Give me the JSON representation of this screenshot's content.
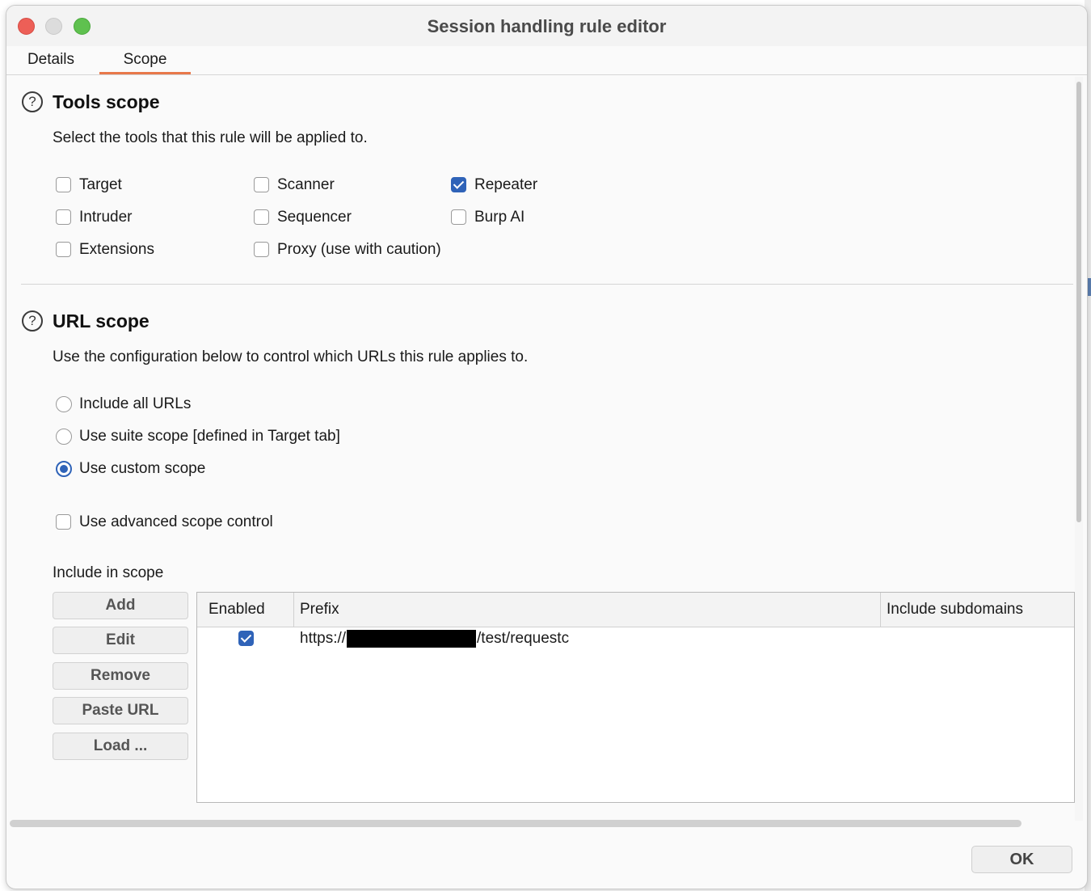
{
  "window": {
    "title": "Session handling rule editor"
  },
  "tabs": [
    {
      "label": "Details",
      "active": false
    },
    {
      "label": "Scope",
      "active": true
    }
  ],
  "tools_scope": {
    "title": "Tools scope",
    "description": "Select the tools that this rule will be applied to.",
    "tools": [
      {
        "label": "Target",
        "checked": false
      },
      {
        "label": "Scanner",
        "checked": false
      },
      {
        "label": "Repeater",
        "checked": true
      },
      {
        "label": "Intruder",
        "checked": false
      },
      {
        "label": "Sequencer",
        "checked": false
      },
      {
        "label": "Burp AI",
        "checked": false
      },
      {
        "label": "Extensions",
        "checked": false
      },
      {
        "label": "Proxy (use with caution)",
        "checked": false
      }
    ]
  },
  "url_scope": {
    "title": "URL scope",
    "description": "Use the configuration below to control which URLs this rule applies to.",
    "options": [
      {
        "label": "Include all URLs",
        "selected": false
      },
      {
        "label": "Use suite scope [defined in Target tab]",
        "selected": false
      },
      {
        "label": "Use custom scope",
        "selected": true
      }
    ],
    "advanced": {
      "label": "Use advanced scope control",
      "checked": false
    },
    "include_label": "Include in scope",
    "buttons": {
      "add": "Add",
      "edit": "Edit",
      "remove": "Remove",
      "paste_url": "Paste URL",
      "load": "Load ..."
    },
    "table": {
      "headers": {
        "enabled": "Enabled",
        "prefix": "Prefix",
        "include_subdomains": "Include subdomains"
      },
      "rows": [
        {
          "enabled": true,
          "prefix_start": "https://",
          "prefix_end": "/test/requestc",
          "include_subdomains": ""
        }
      ]
    }
  },
  "footer": {
    "ok_label": "OK"
  },
  "colors": {
    "accent": "#2f63b8",
    "tab_underline": "#e8784a"
  }
}
